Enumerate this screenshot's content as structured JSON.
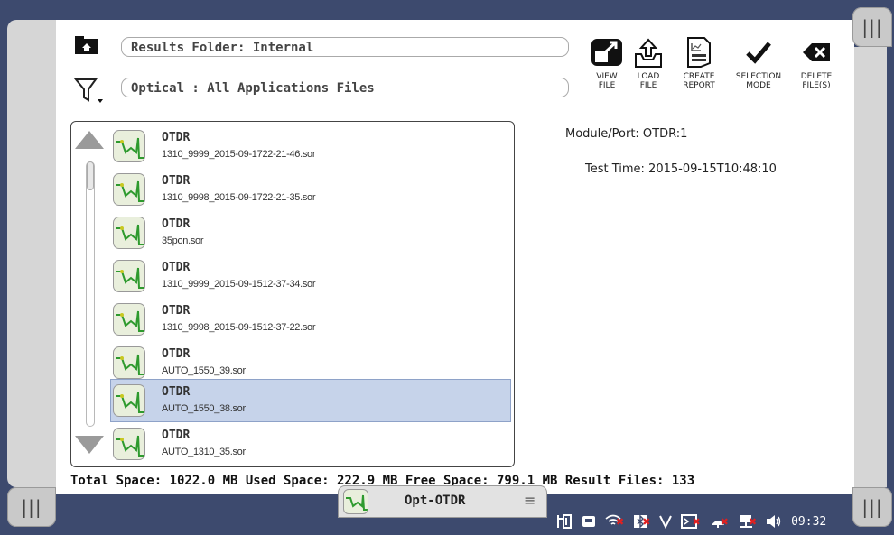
{
  "header": {
    "folder_field": "Results Folder: Internal",
    "filter_field": "Optical : All Applications Files"
  },
  "toolbar": {
    "view_file": "VIEW\nFILE",
    "load_file": "LOAD\nFILE",
    "create_report": "CREATE\nREPORT",
    "selection_mode": "SELECTION\nMODE",
    "delete_files": "DELETE\nFILE(S)"
  },
  "files": [
    {
      "title": "OTDR",
      "name": "1310_9999_2015-09-1722-21-46.sor"
    },
    {
      "title": "OTDR",
      "name": "1310_9998_2015-09-1722-21-35.sor"
    },
    {
      "title": "OTDR",
      "name": "35pon.sor"
    },
    {
      "title": "OTDR",
      "name": "1310_9999_2015-09-1512-37-34.sor"
    },
    {
      "title": "OTDR",
      "name": "1310_9998_2015-09-1512-37-22.sor"
    },
    {
      "title": "OTDR",
      "name": "AUTO_1550_39.sor"
    },
    {
      "title": "OTDR",
      "name": "AUTO_1550_38.sor",
      "selected": true
    },
    {
      "title": "OTDR",
      "name": "AUTO_1310_35.sor"
    }
  ],
  "details": {
    "module_port": "Module/Port: OTDR:1",
    "test_time": "Test Time: 2015-09-15T10:48:10"
  },
  "footer": {
    "stats": "Total Space: 1022.0 MB  Used Space: 222.9 MB  Free Space: 799.1 MB  Result Files: 133"
  },
  "taskbar": {
    "app_name": "Opt-OTDR",
    "menu_glyph": "≡",
    "clock": "09:32"
  },
  "handles": {
    "glyph": "|||"
  },
  "colors": {
    "frame": "#3d4a6e",
    "selected_row": "#c6d3ea",
    "error_x": "#e02020"
  }
}
